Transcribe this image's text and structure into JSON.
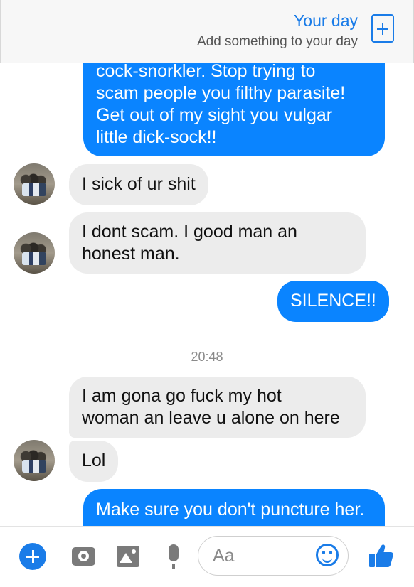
{
  "your_day": {
    "title": "Your day",
    "subtitle": "Add something to your day",
    "add_icon": "plus-square-icon"
  },
  "messages": [
    {
      "sender": "me",
      "lines": [
        "cock-snorkler. Stop trying to",
        "scam people you filthy parasite!",
        "Get out of my sight you vulgar",
        "little dick-sock!!"
      ]
    },
    {
      "sender": "contact",
      "lines": [
        "I sick of ur shit"
      ]
    },
    {
      "sender": "contact",
      "lines": [
        "I dont scam. I good man an",
        "honest man."
      ]
    },
    {
      "sender": "me",
      "lines": [
        "SILENCE!!"
      ]
    },
    {
      "sender": "contact",
      "lines": [
        "I am gona go fuck my hot",
        "woman an leave u alone on here"
      ]
    },
    {
      "sender": "contact",
      "lines": [
        "Lol"
      ]
    },
    {
      "sender": "me",
      "lines": [
        "Make sure you don't puncture her."
      ]
    }
  ],
  "timestamp": "20:48",
  "composer": {
    "placeholder": "Aa",
    "icons": [
      "plus-icon",
      "camera-icon",
      "image-icon",
      "microphone-icon",
      "emoji-icon",
      "thumbs-up-icon"
    ]
  },
  "colors": {
    "outgoing_bubble": "#0a84ff",
    "incoming_bubble": "#ececec",
    "accent": "#1a7ce8"
  }
}
